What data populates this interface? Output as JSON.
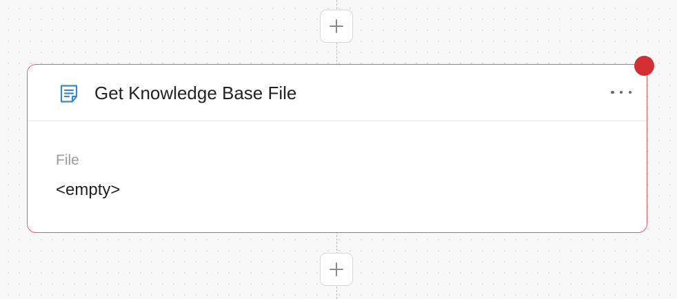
{
  "node": {
    "title": "Get Knowledge Base File",
    "icon": "document-icon",
    "status": "error",
    "status_color": "#d12f35",
    "border_color": "#d9636b",
    "accent_color": "#3a86c8",
    "field": {
      "label": "File",
      "value": "<empty>"
    }
  },
  "canvas": {
    "add_icon": "plus-icon",
    "more_icon": "more-horizontal-icon"
  }
}
